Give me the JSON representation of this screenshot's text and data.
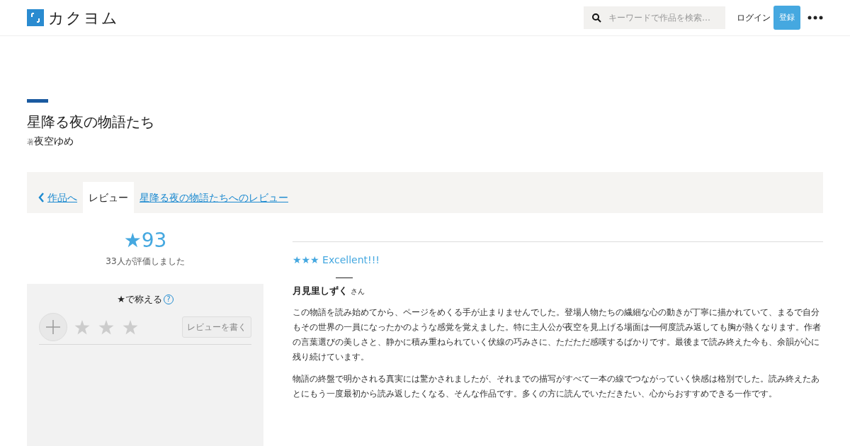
{
  "header": {
    "logo": "カクヨム",
    "search": {
      "placeholder": "キーワードで作品を検索…"
    },
    "login": "ログイン",
    "signup": "登録"
  },
  "work": {
    "title": "星降る夜の物語たち",
    "author_prefix": "著",
    "author": "夜空ゆめ"
  },
  "nav": {
    "back": "作品へ",
    "tab": "レビュー",
    "crumb": "星降る夜の物語たちへのレビュー"
  },
  "rating": {
    "score": "★93",
    "count": "33人が評価しました"
  },
  "praise": {
    "title": "★で称える",
    "help": "?",
    "write": "レビューを書く"
  },
  "review": {
    "headline": "★★★ Excellent!!!",
    "reviewer": "月見里しずく",
    "reviewer_suffix": "さん",
    "paragraphs": [
      "この物語を読み始めてから、ページをめくる手が止まりませんでした。登場人物たちの繊細な心の動きが丁寧に描かれていて、まるで自分もその世界の一員になったかのような感覚を覚えました。特に主人公が夜空を見上げる場面は──何度読み返しても胸が熱くなります。作者の言葉選びの美しさと、静かに積み重ねられていく伏線の巧みさに、ただただ感嘆するばかりです。最後まで読み終えた今も、余韻が心に残り続けています。",
      "物語の終盤で明かされる真実には驚かされましたが、それまでの描写がすべて一本の線でつながっていく快感は格別でした。読み終えたあとにもう一度最初から読み返したくなる、そんな作品です。多くの方に読んでいただきたい、心からおすすめできる一作です。"
    ]
  }
}
